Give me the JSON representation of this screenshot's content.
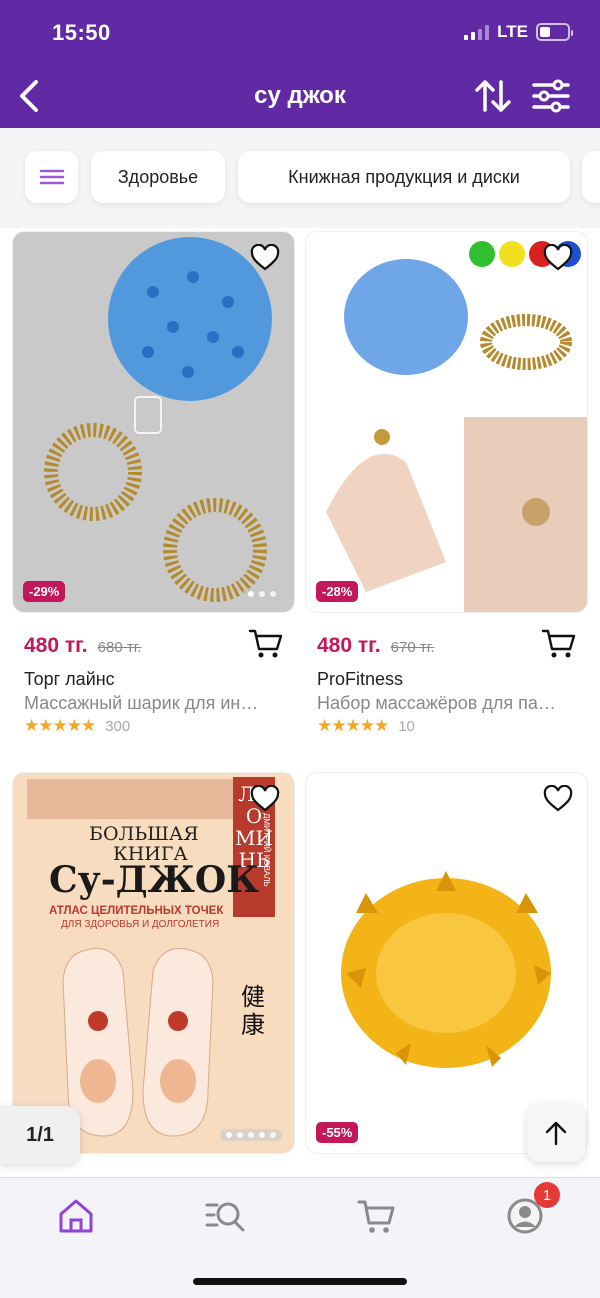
{
  "status_bar": {
    "time": "15:50",
    "network": "LTE",
    "battery_level": 0.3
  },
  "header": {
    "title": "су джок"
  },
  "categories": [
    "Здоровье",
    "Книжная продукция и диски"
  ],
  "products": [
    {
      "price": "480 тг.",
      "old_price": "680 тг.",
      "discount": "-29%",
      "brand": "Торг лайнс",
      "description": "Массажный шарик для ин…",
      "rating": 5,
      "reviews": "300"
    },
    {
      "price": "480 тг.",
      "old_price": "670 тг.",
      "discount": "-28%",
      "brand": "ProFitness",
      "description": "Набор массажёров для па…",
      "rating": 5,
      "reviews": "10"
    },
    {
      "discount": ""
    },
    {
      "discount": "-55%"
    }
  ],
  "book_cover": {
    "line1": "БОЛЬШАЯ",
    "line2": "КНИГА",
    "line3": "Су-ДЖОК",
    "subtitle": "АТЛАС ЦЕЛИТЕЛЬНЫХ ТОЧЕК",
    "subtitle2": "ДЛЯ ЗДОРОВЬЯ И ДОЛГОЛЕТИЯ",
    "author": "ЛАО МИНЬ",
    "coauthor": "ДМИТРИЙ КОВАЛЬ",
    "hieroglyph": "健康"
  },
  "pagination": {
    "label": "1/1"
  },
  "tabbar": {
    "cart_badge": "1"
  },
  "colors": {
    "brand": "#6229a5",
    "price": "#c2185b",
    "star": "#f5a623"
  },
  "icons": [
    "back-icon",
    "sort-icon",
    "filter-icon",
    "menu-icon",
    "heart-icon",
    "cart-icon",
    "arrow-up-icon",
    "home-icon",
    "search-list-icon",
    "basket-icon",
    "profile-icon"
  ]
}
